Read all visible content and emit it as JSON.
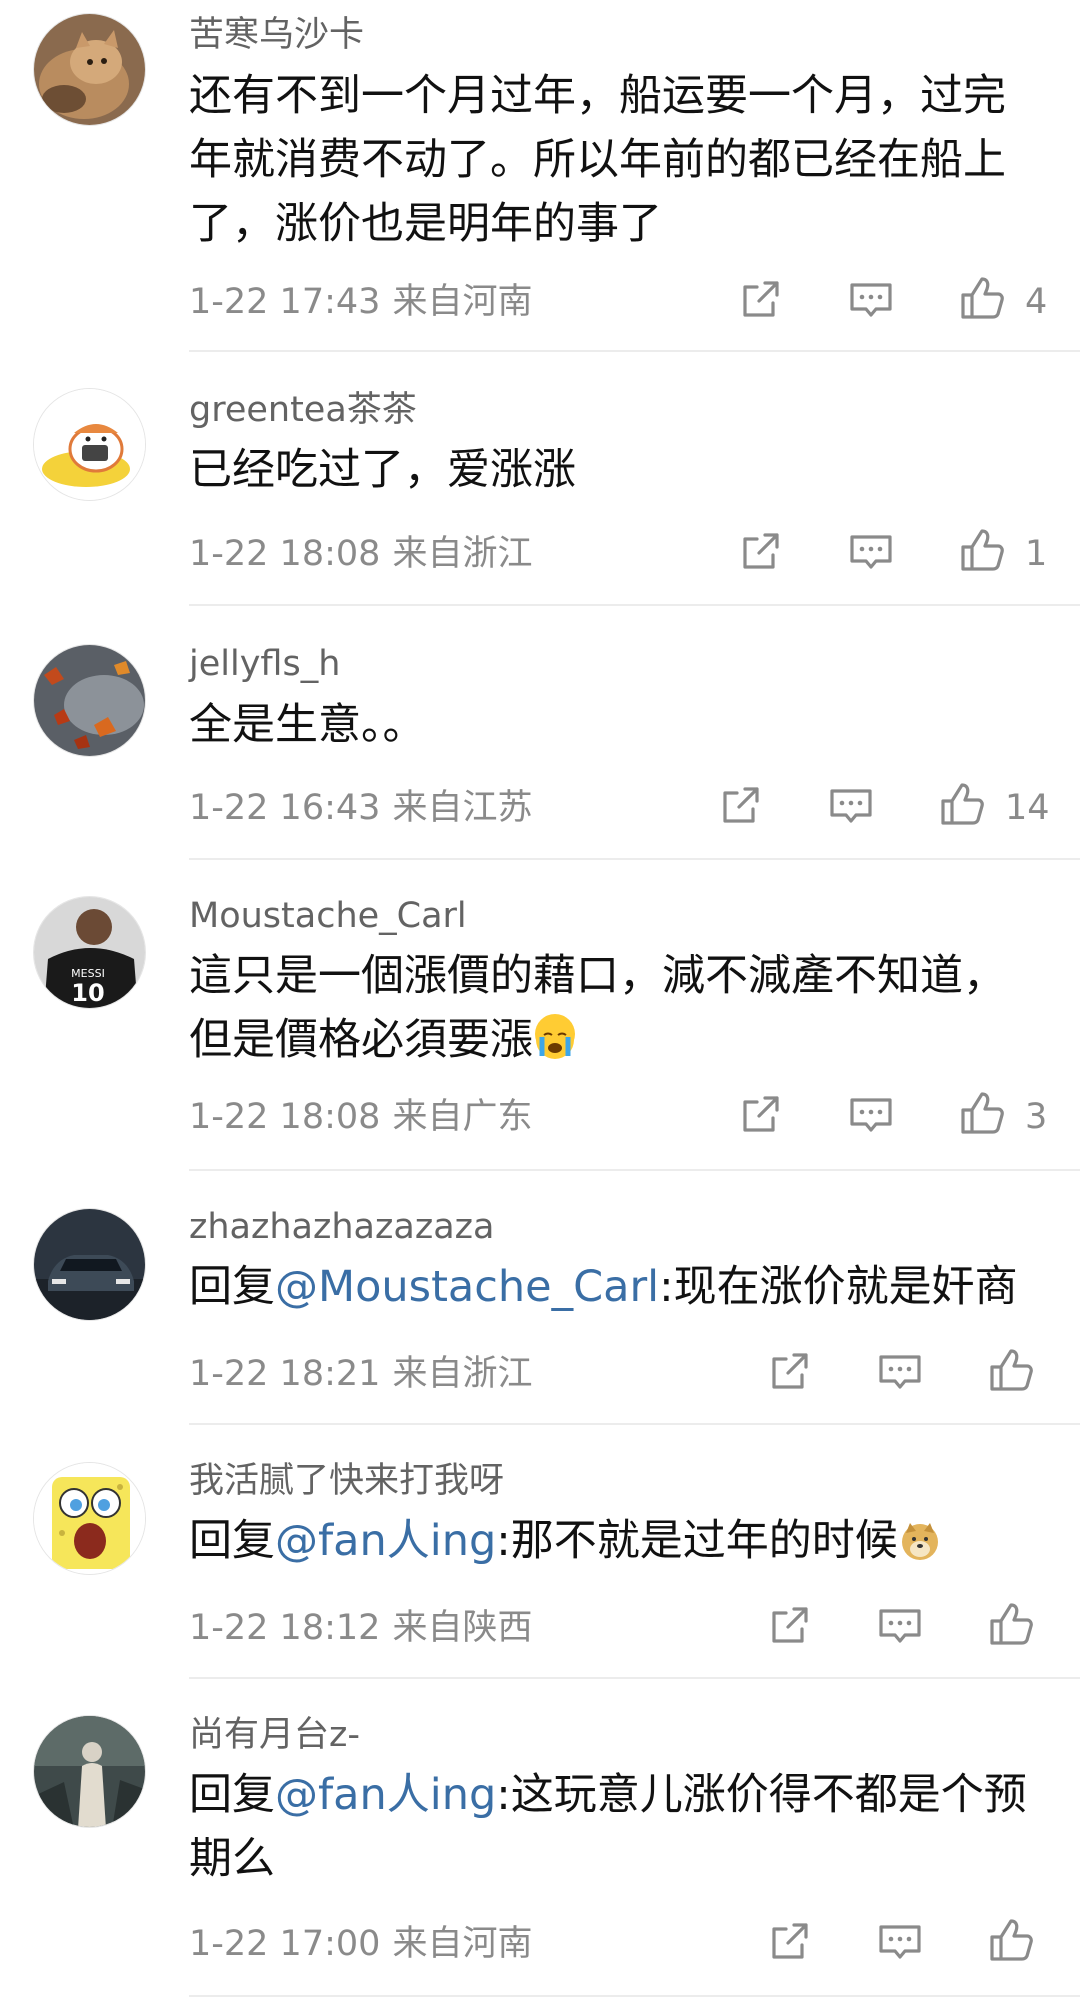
{
  "comments": [
    {
      "username": "苦寒乌沙卡",
      "lines": [
        "还有不到一个月过年，船运要一个月，过完",
        "年就消费不动了。所以年前的都已经在船上",
        "了，涨价也是明年的事了"
      ],
      "date": "1-22 17:43",
      "location": "来自河南",
      "likes": "4",
      "avatar_icon": "cat-avatar"
    },
    {
      "username": "greentea茶茶",
      "lines": [
        "已经吃过了，爱涨涨"
      ],
      "date": "1-22 18:08",
      "location": "来自浙江",
      "likes": "1",
      "avatar_icon": "cartoon-cat-avatar"
    },
    {
      "username": "jellyfls_h",
      "lines": [
        "全是生意。。"
      ],
      "date": "1-22 16:43",
      "location": "来自江苏",
      "likes": "14",
      "avatar_icon": "autumn-leaves-avatar"
    },
    {
      "username": "Moustache_Carl",
      "lines": [
        "這只是一個漲價的藉口，減不減產不知道，",
        "但是價格必須要漲"
      ],
      "trailing_emoji": "crying-face-emoji",
      "date": "1-22 18:08",
      "location": "来自广东",
      "likes": "3",
      "avatar_icon": "messi-jersey-avatar",
      "jersey_text": "MESSI 10"
    },
    {
      "username": "zhazhazhazazaza",
      "reply_prefix": "回复",
      "mention": "@Moustache_Carl",
      "lines": [
        ":现在涨价就是奸商"
      ],
      "date": "1-22 18:21",
      "location": "来自浙江",
      "likes": "",
      "avatar_icon": "car-avatar"
    },
    {
      "username": "我活腻了快来打我呀",
      "reply_prefix": "回复",
      "mention": "@fan人ing",
      "lines": [
        ":那不就是过年的时候"
      ],
      "trailing_emoji": "doge-emoji",
      "date": "1-22 18:12",
      "location": "来自陕西",
      "likes": "",
      "avatar_icon": "spongebob-avatar"
    },
    {
      "username": "尚有月台z-",
      "reply_prefix": "回复",
      "mention": "@fan人ing",
      "lines": [
        ":这玩意儿涨价得不都是个预",
        "期么"
      ],
      "date": "1-22 17:00",
      "location": "来自河南",
      "likes": "",
      "avatar_icon": "figure-silhouette-avatar"
    }
  ],
  "actions": {
    "share_icon": "share-icon",
    "comment_icon": "comment-icon",
    "like_icon": "thumbs-up-icon"
  },
  "colors": {
    "username": "#636363",
    "body": "#111111",
    "mention": "#3a6ea5",
    "meta": "#8a8a8a",
    "divider": "#ececec"
  }
}
